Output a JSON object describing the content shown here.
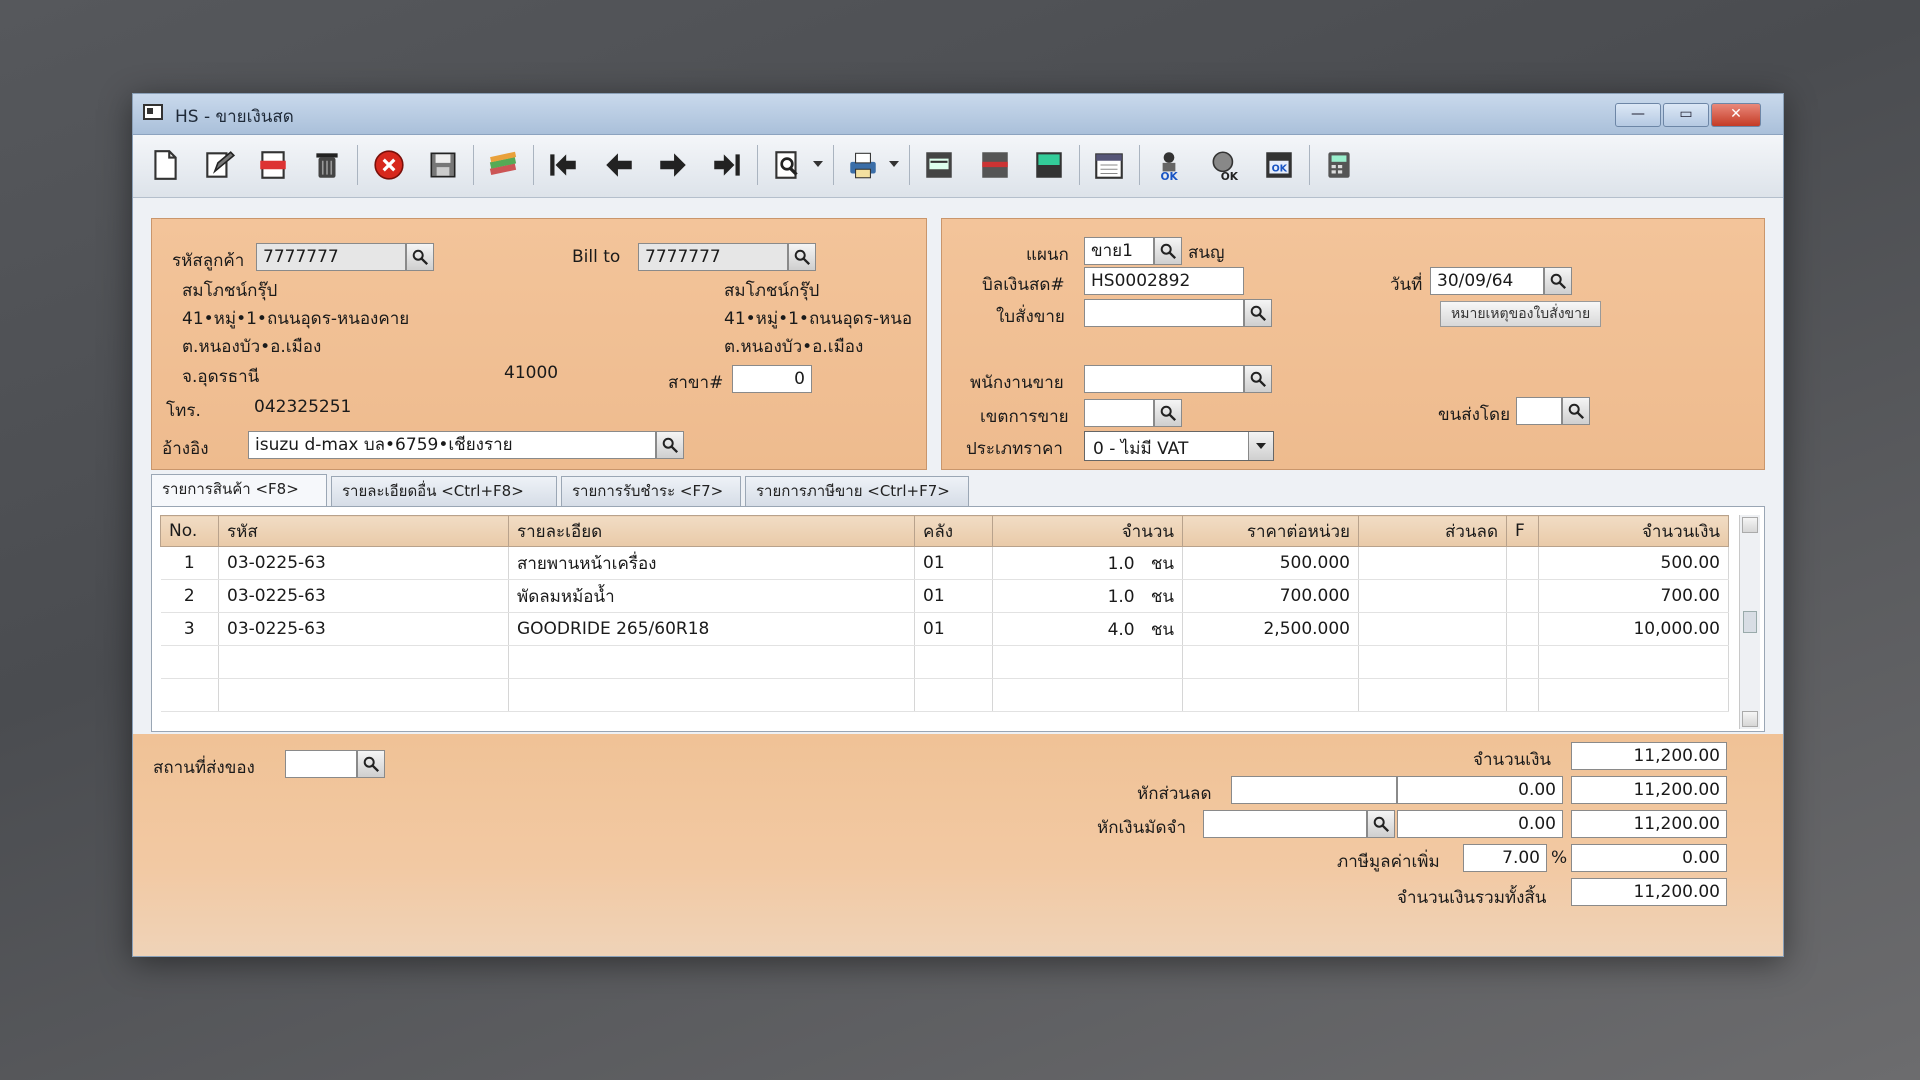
{
  "window": {
    "title": "HS - ขายเงินสด",
    "controls": {
      "minimize": "—",
      "maximize": "▭",
      "close": "✕"
    }
  },
  "toolbar": {
    "icons": [
      "new-doc-icon",
      "edit-icon",
      "cancel-doc-icon",
      "trash-icon",
      "close-red-icon",
      "save-icon",
      "books-icon",
      "first-icon",
      "prev-icon",
      "next-icon",
      "last-icon",
      "search-doc-icon",
      "printer-icon",
      "report1-icon",
      "report2-icon",
      "report3-icon",
      "calendar-icon",
      "ok1-icon",
      "ok2-icon",
      "ok3-icon",
      "calculator-icon"
    ]
  },
  "customer": {
    "code_label": "รหัสลูกค้า",
    "code_value": "7777777",
    "name": "สมโภชน์กรุ๊ป",
    "address1": "41•หมู่•1•ถนนอุดร-หนองคาย",
    "address2": "ต.หนองบัว•อ.เมือง",
    "province": "จ.อุดรธานี",
    "postcode": "41000",
    "phone_label": "โทร.",
    "phone": "042325251",
    "ref_label": "อ้างอิง",
    "ref_value": "isuzu d-max บล•6759•เชียงราย"
  },
  "billto": {
    "label": "Bill to",
    "value": "7777777",
    "name": "สมโภชน์กรุ๊ป",
    "address1": "41•หมู่•1•ถนนอุดร-หนอ",
    "address2": "ต.หนองบัว•อ.เมือง",
    "branch_label": "สาขา#",
    "branch_value": "0"
  },
  "doc": {
    "dept_label": "แผนก",
    "dept_value": "ขาย1",
    "dept_name": "สนญ",
    "bill_label": "บิลเงินสด#",
    "bill_value": "HS0002892",
    "date_label": "วันที่",
    "date_value": "30/09/64",
    "so_label": "ใบสั่งขาย",
    "so_value": "",
    "note_button": "หมายเหตุของใบสั่งขาย",
    "sales_label": "พนักงานขาย",
    "area_label": "เขตการขาย",
    "ship_label": "ขนส่งโดย",
    "price_type_label": "ประเภทราคา",
    "price_type_value": "0 - ไม่มี VAT"
  },
  "tabs": [
    {
      "label": "รายการสินค้า <F8>"
    },
    {
      "label": "รายละเอียดอื่น <Ctrl+F8>"
    },
    {
      "label": "รายการรับชำระ <F7>"
    },
    {
      "label": "รายการภาษีขาย <Ctrl+F7>"
    }
  ],
  "grid": {
    "headers": [
      "No.",
      "รหัส",
      "รายละเอียด",
      "คลัง",
      "จำนวน",
      "ราคาต่อหน่วย",
      "ส่วนลด",
      "F",
      "จำนวนเงิน"
    ],
    "rows": [
      {
        "no": "1",
        "code": "03-0225-63",
        "desc": "สายพานหน้าเครื่อง",
        "wh": "01",
        "qty": "1.0",
        "unit": "ชน",
        "price": "500.000",
        "disc": "",
        "f": "",
        "amount": "500.00"
      },
      {
        "no": "2",
        "code": "03-0225-63",
        "desc": "พัดลมหม้อน้ำ",
        "wh": "01",
        "qty": "1.0",
        "unit": "ชน",
        "price": "700.000",
        "disc": "",
        "f": "",
        "amount": "700.00"
      },
      {
        "no": "3",
        "code": "03-0225-63",
        "desc": "GOODRIDE 265/60R18",
        "wh": "01",
        "qty": "4.0",
        "unit": "ชน",
        "price": "2,500.000",
        "disc": "",
        "f": "",
        "amount": "10,000.00"
      }
    ]
  },
  "footer": {
    "ship_place_label": "สถานที่ส่งของ",
    "amount_label": "จำนวนเงิน",
    "amount_value": "11,200.00",
    "discount_label": "หักส่วนลด",
    "discount_value": "0.00",
    "after_discount": "11,200.00",
    "deposit_label": "หักเงินมัดจำ",
    "deposit_value": "0.00",
    "after_deposit": "11,200.00",
    "vat_label": "ภาษีมูลค่าเพิ่ม",
    "vat_rate": "7.00",
    "vat_pct": "%",
    "vat_value": "0.00",
    "total_label": "จำนวนเงินรวมทั้งสิ้น",
    "total_value": "11,200.00"
  }
}
